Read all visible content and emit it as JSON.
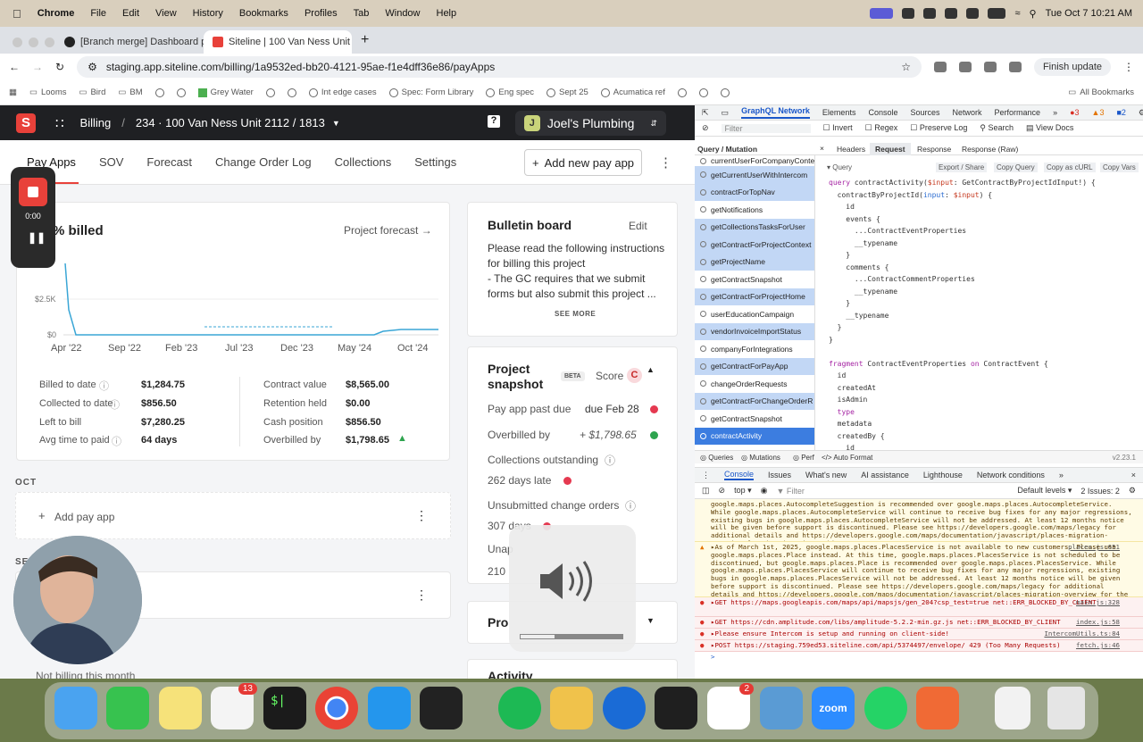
{
  "menubar": {
    "app": "Chrome",
    "items": [
      "File",
      "Edit",
      "View",
      "History",
      "Bookmarks",
      "Profiles",
      "Tab",
      "Window",
      "Help"
    ],
    "datetime": "Tue Oct 7  10:21 AM"
  },
  "browser": {
    "tabs": [
      "[Branch merge] Dashboard p",
      "Siteline | 100 Van Ness Unit 2"
    ],
    "url": "staging.app.siteline.com/billing/1a9532ed-bb20-4121-95ae-f1e4dff36e86/payApps",
    "finish_update": "Finish update",
    "bookmarks": [
      "Looms",
      "Bird",
      "BM",
      "Grey Water",
      "Int edge cases",
      "Spec: Form Library",
      "Eng spec",
      "Sept 25",
      "Acumatica ref"
    ],
    "all_bookmarks": "All Bookmarks"
  },
  "app": {
    "section": "Billing",
    "breadcrumb": "234 · 100 Van Ness Unit 2112 / 1813",
    "company": "Joel's Plumbing",
    "company_initial": "J",
    "tabs": [
      "Pay Apps",
      "SOV",
      "Forecast",
      "Change Order Log",
      "Collections",
      "Settings"
    ],
    "add_pay_app": "Add new pay app",
    "billed": {
      "title": "% billed",
      "forecast_link": "Project forecast",
      "chart_yticks": [
        "$2.5K",
        "$0"
      ],
      "chart_xticks": [
        "Apr '22",
        "Sep '22",
        "Feb '23",
        "Jul '23",
        "Dec '23",
        "May '24",
        "Oct '24"
      ],
      "stats_left": [
        {
          "label": "Billed to date",
          "value": "$1,284.75"
        },
        {
          "label": "Collected to date",
          "value": "$856.50"
        },
        {
          "label": "Left to bill",
          "value": "$7,280.25"
        },
        {
          "label": "Avg time to paid",
          "value": "64 days"
        }
      ],
      "stats_right": [
        {
          "label": "Contract value",
          "value": "$8,565.00"
        },
        {
          "label": "Retention held",
          "value": "$0.00"
        },
        {
          "label": "Cash position",
          "value": "$856.50"
        },
        {
          "label": "Overbilled by",
          "value": "$1,798.65"
        }
      ]
    },
    "month_oct": "OCT",
    "add_pay_app_row": "Add pay app",
    "month_sep": "SE",
    "not_billing": "Not billing this month",
    "bulletin": {
      "title": "Bulletin board",
      "edit": "Edit",
      "text": "Please read the following instructions for billing this project\n- The GC requires that we submit forms but also submit this project ...",
      "see_more": "SEE MORE"
    },
    "snapshot": {
      "title": "Project snapshot",
      "beta": "BETA",
      "score_label": "Score",
      "score": "C",
      "rows": [
        {
          "label": "Pay app past due",
          "value": "due Feb 28"
        },
        {
          "label": "Overbilled by",
          "value": "+ $1,798.65"
        },
        {
          "label": "Collections outstanding",
          "value": "262 days late"
        },
        {
          "label": "Unsubmitted change orders",
          "value": "307 days"
        },
        {
          "label": "Unap",
          "value": "210"
        }
      ]
    },
    "pro_label": "Pro",
    "activity": "Activity"
  },
  "recorder": {
    "time": "0:00"
  },
  "devtools": {
    "tabs": [
      "GraphQL Network",
      "Elements",
      "Console",
      "Sources",
      "Network",
      "Performance"
    ],
    "errors": "3",
    "warnings": "3",
    "info": "2",
    "filter": "Filter",
    "invert": "Invert",
    "regex": "Regex",
    "preserve": "Preserve Log",
    "search": "Search",
    "docs": "View Docs",
    "op_header": "Query / Mutation",
    "req_tabs": [
      "Headers",
      "Request",
      "Response",
      "Response (Raw)"
    ],
    "query_label": "Query",
    "actions": [
      "Export / Share",
      "Copy Query",
      "Copy as cURL",
      "Copy Vars"
    ],
    "operations": [
      "currentUserForCompanyConte",
      "getCurrentUserWithIntercom",
      "contractForTopNav",
      "getNotifications",
      "getCollectionsTasksForUser",
      "getContractForProjectContext",
      "getProjectName",
      "getContractSnapshot",
      "getContractForProjectHome",
      "userEducationCampaign",
      "vendorInvoiceImportStatus",
      "companyForIntegrations",
      "getContractForPayApp",
      "changeOrderRequests",
      "getContractForChangeOrderR",
      "getContractSnapshot",
      "contractActivity"
    ],
    "bottom_tabs": [
      "Queries",
      "Mutations",
      "Perf",
      "Auto Format"
    ],
    "version": "v2.23.1",
    "console_tabs": [
      "Console",
      "Issues",
      "What's new",
      "AI assistance",
      "Lighthouse",
      "Network conditions"
    ],
    "context": "top",
    "levels": "Default levels",
    "issues": "2 Issues: 2",
    "logs": [
      {
        "type": "warn",
        "text": "google.maps.places.AutocompleteSuggestion is recommended over google.maps.places.AutocompleteService. While google.maps.places.AutocompleteService will continue to receive bug fixes for any major regressions, existing bugs in google.maps.places.AutocompleteService will not be addressed. At least 12 months notice will be given before support is discontinued. Please see https://developers.google.com/maps/legacy for additional details and https://developers.google.com/maps/documentation/javascript/places-migration-overview for the migration guide.",
        "src": ""
      },
      {
        "type": "warn",
        "text": "▸As of March 1st, 2025, google.maps.places.PlacesService is not available to new customers. Please use google.maps.places.Place instead. At this time, google.maps.places.PlacesService is not scheduled to be discontinued, but google.maps.places.Place is recommended over google.maps.places.PlacesService. While google.maps.places.PlacesService will continue to receive bug fixes for any major regressions, existing bugs in google.maps.places.PlacesService will not be addressed. At least 12 months notice will be given before support is discontinued. Please see https://developers.google.com/maps/legacy for additional details and https://developers.google.com/maps/documentation/javascript/places-migration-overview for the migration guide.",
        "src": "places.js:651"
      },
      {
        "type": "err",
        "text": "▸GET https://maps.googleapis.com/maps/api/mapsjs/gen_204?csp_test=true net::ERR_BLOCKED_BY_CLIENT",
        "src": "main.js:328"
      },
      {
        "type": "err",
        "text": "▸GET https://cdn.amplitude.com/libs/amplitude-5.2.2-min.gz.js net::ERR_BLOCKED_BY_CLIENT",
        "src": "index.js:58"
      },
      {
        "type": "err",
        "text": "▸Please ensure Intercom is setup and running on client-side!",
        "src": "IntercomUtils.ts:84"
      },
      {
        "type": "err",
        "text": "▸POST https://staging.759ed53.siteline.com/api/5374497/envelope/ 429 (Too Many Requests)",
        "src": "fetch.js:46"
      }
    ]
  },
  "dock": {
    "reminders_badge": "13",
    "slack_badge": "2",
    "zoom_label": "zoom"
  }
}
